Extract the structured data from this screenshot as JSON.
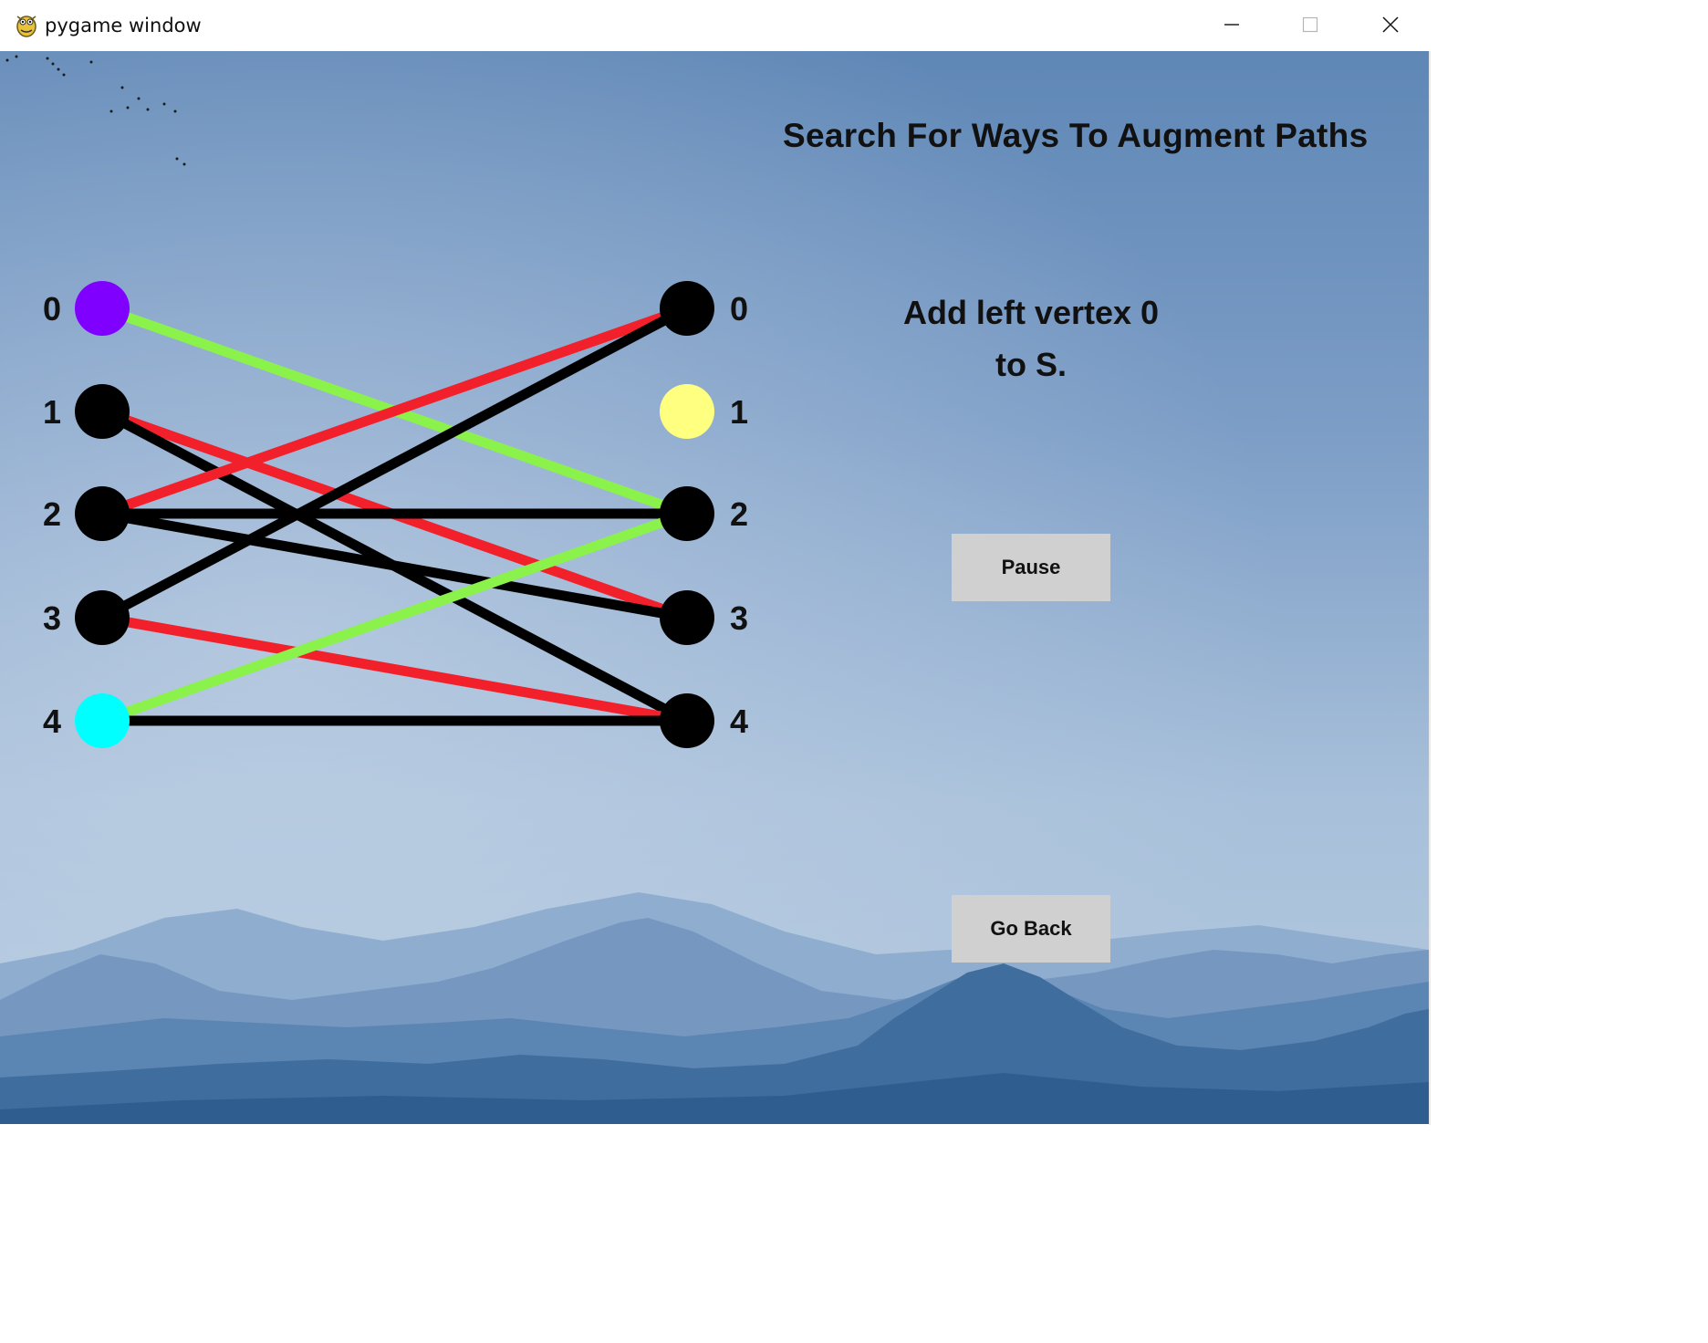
{
  "window": {
    "title": "pygame window",
    "app_icon": "pygame-snake-icon",
    "controls": {
      "minimize_icon": "minimize-icon",
      "maximize_icon": "maximize-icon",
      "close_icon": "close-icon"
    }
  },
  "main": {
    "heading": "Search For Ways To Augment Paths",
    "message_line1": "Add left vertex 0",
    "message_line2": "to S.",
    "pause_label": "Pause",
    "go_back_label": "Go Back"
  },
  "graph": {
    "left_vertices": [
      {
        "label": "0",
        "color": "#8000ff"
      },
      {
        "label": "1",
        "color": "#000000"
      },
      {
        "label": "2",
        "color": "#000000"
      },
      {
        "label": "3",
        "color": "#000000"
      },
      {
        "label": "4",
        "color": "#00ffff"
      }
    ],
    "right_vertices": [
      {
        "label": "0",
        "color": "#000000"
      },
      {
        "label": "1",
        "color": "#ffff80"
      },
      {
        "label": "2",
        "color": "#000000"
      },
      {
        "label": "3",
        "color": "#000000"
      },
      {
        "label": "4",
        "color": "#000000"
      }
    ],
    "edges": [
      {
        "from": 0,
        "to": 2,
        "color": "#8af24a"
      },
      {
        "from": 1,
        "to": 3,
        "color": "#f2202a"
      },
      {
        "from": 1,
        "to": 4,
        "color": "#000000"
      },
      {
        "from": 2,
        "to": 0,
        "color": "#f2202a"
      },
      {
        "from": 2,
        "to": 2,
        "color": "#000000"
      },
      {
        "from": 2,
        "to": 3,
        "color": "#000000"
      },
      {
        "from": 3,
        "to": 0,
        "color": "#000000"
      },
      {
        "from": 3,
        "to": 4,
        "color": "#f2202a"
      },
      {
        "from": 4,
        "to": 2,
        "color": "#8af24a"
      },
      {
        "from": 4,
        "to": 4,
        "color": "#000000"
      }
    ]
  }
}
